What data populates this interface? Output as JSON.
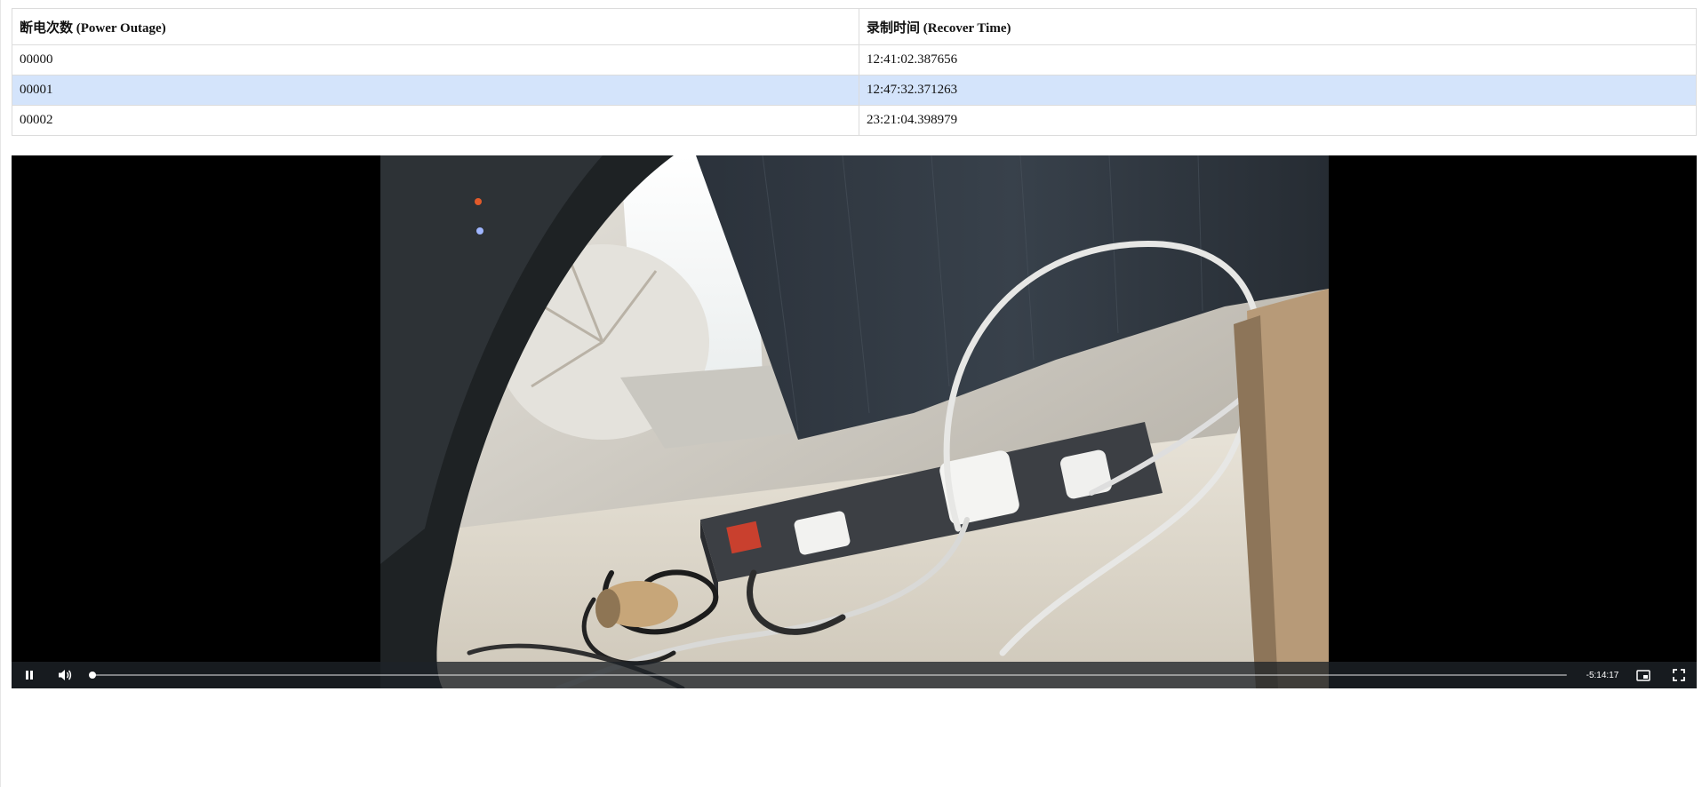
{
  "table": {
    "headers": [
      "断电次数 (Power Outage)",
      "录制时间 (Recover Time)"
    ],
    "rows": [
      {
        "outage": "00000",
        "recover_time": "12:41:02.387656"
      },
      {
        "outage": "00001",
        "recover_time": "12:47:32.371263"
      },
      {
        "outage": "00002",
        "recover_time": "23:21:04.398979"
      }
    ],
    "selected_row": 1,
    "selected_color": "#d4e4fb"
  },
  "video": {
    "time_remaining": "-5:14:17",
    "progress": 0.002,
    "playing": true,
    "icons": {
      "play_pause": "pause-icon",
      "volume": "volume-icon",
      "pip": "picture-in-picture-icon",
      "fullscreen": "fullscreen-icon"
    }
  }
}
